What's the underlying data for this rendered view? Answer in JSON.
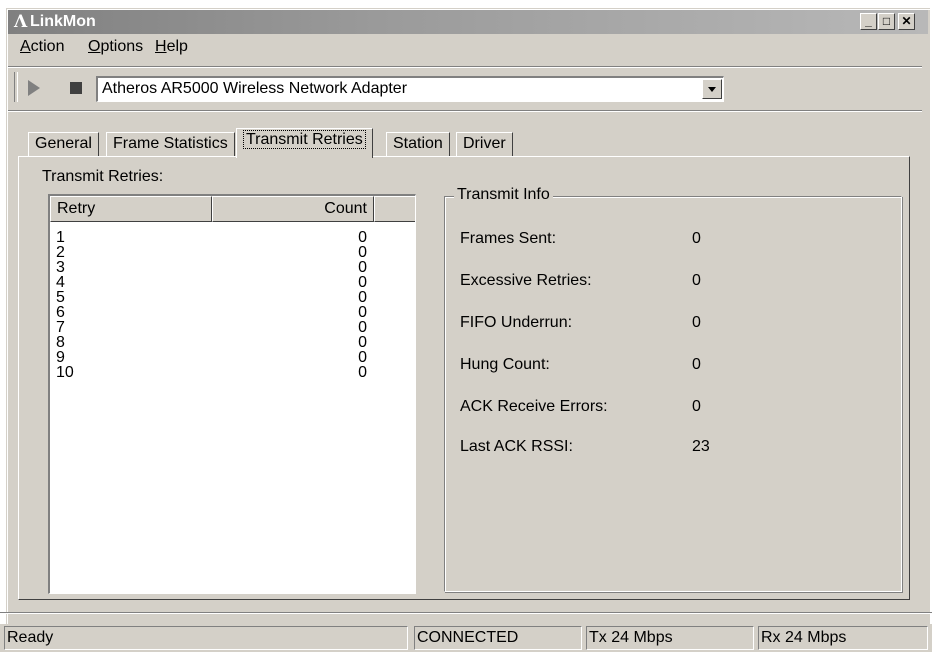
{
  "window": {
    "title": "LinkMon",
    "controls": {
      "minimize": "_",
      "maximize": "□",
      "close": "✕"
    }
  },
  "menu": {
    "items": [
      {
        "label": "Action",
        "accel": "A",
        "rest": "ction"
      },
      {
        "label": "Options",
        "accel": "O",
        "rest": "ptions"
      },
      {
        "label": "Help",
        "accel": "H",
        "rest": "elp"
      }
    ]
  },
  "toolbar": {
    "play_icon": "play-icon",
    "stop_icon": "stop-icon",
    "adapter": "Atheros AR5000 Wireless Network Adapter"
  },
  "tabs": [
    {
      "label": "General",
      "active": false
    },
    {
      "label": "Frame Statistics",
      "active": false
    },
    {
      "label": "Transmit Retries",
      "active": true
    },
    {
      "label": "Station",
      "active": false
    },
    {
      "label": "Driver",
      "active": false
    }
  ],
  "retries": {
    "label": "Transmit Retries:",
    "columns": [
      "Retry",
      "Count"
    ],
    "rows": [
      [
        "1",
        "0"
      ],
      [
        "2",
        "0"
      ],
      [
        "3",
        "0"
      ],
      [
        "4",
        "0"
      ],
      [
        "5",
        "0"
      ],
      [
        "6",
        "0"
      ],
      [
        "7",
        "0"
      ],
      [
        "8",
        "0"
      ],
      [
        "9",
        "0"
      ],
      [
        "10",
        "0"
      ]
    ]
  },
  "transmit_info": {
    "title": "Transmit Info",
    "fields": [
      {
        "label": "Frames Sent:",
        "value": "0"
      },
      {
        "label": "Excessive Retries:",
        "value": "0"
      },
      {
        "label": "FIFO Underrun:",
        "value": "0"
      },
      {
        "label": "Hung Count:",
        "value": "0"
      },
      {
        "label": "ACK Receive Errors:",
        "value": "0"
      },
      {
        "label": "Last ACK RSSI:",
        "value": "23"
      }
    ]
  },
  "status": {
    "message": "Ready",
    "connection": "CONNECTED",
    "tx": "Tx 24 Mbps",
    "rx": "Rx 24 Mbps"
  }
}
